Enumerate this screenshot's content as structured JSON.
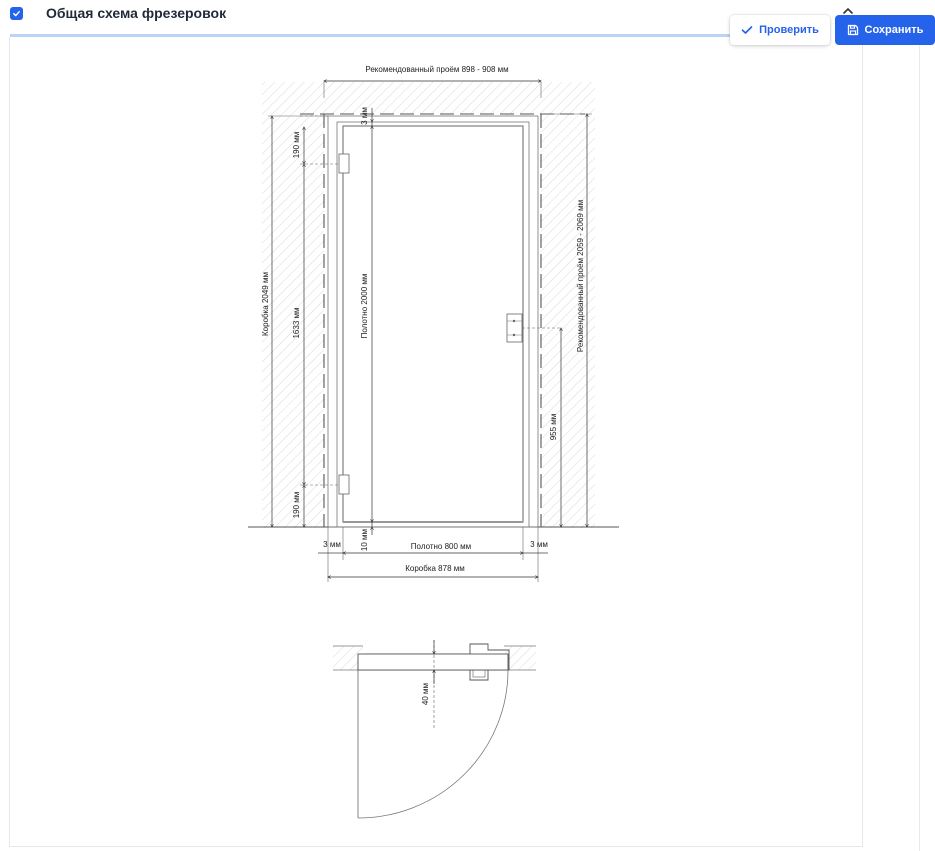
{
  "header": {
    "title": "Общая схема фрезеровок"
  },
  "toolbar": {
    "check_label": "Проверить",
    "save_label": "Сохранить"
  },
  "icons": {
    "checkbox": "checkmark-icon",
    "chevron": "chevron-up-icon",
    "check": "check-icon",
    "save": "save-icon"
  },
  "colors": {
    "accent": "#2563eb",
    "accent_light": "#bcd3f5"
  },
  "drawing": {
    "front_view": {
      "recommended_opening_width": "Рекомендованный проём 898 - 908 мм",
      "recommended_opening_height": "Рекомендованный проём 2059 - 2069 мм",
      "frame_height": "Коробка 2049 мм",
      "leaf_height": "Полотно 2000 мм",
      "top_gap": "3 мм",
      "top_hinge_offset": "190 мм",
      "hinge_spacing": "1633 мм",
      "bottom_hinge_offset": "190 мм",
      "handle_height": "955 мм",
      "bottom_gap": "10 мм",
      "left_gap": "3 мм",
      "right_gap": "3 мм",
      "leaf_width": "Полотно 800 мм",
      "frame_width": "Коробка 878 мм"
    },
    "section_view": {
      "leaf_thickness": "40 мм"
    }
  }
}
